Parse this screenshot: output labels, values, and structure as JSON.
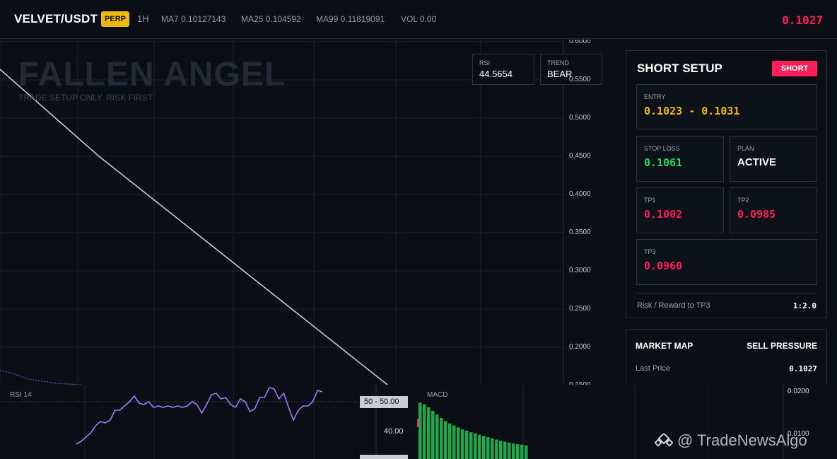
{
  "header": {
    "pair": "VELVET/USDT",
    "badge": "PERP",
    "timeframe": "1H",
    "ma7": "MA7 0.10127143",
    "ma25": "MA25 0.104592",
    "ma99": "MA99 0.11819091",
    "vol": "VOL 0.00",
    "last_price": "0.1027"
  },
  "chart": {
    "brand": "FALLEN ANGEL",
    "brand_sub": "TRADE SETUP ONLY. RISK FIRST.",
    "rsi_chip": {
      "label": "RSI",
      "value": "44.5654"
    },
    "trend_chip": {
      "label": "TREND",
      "value": "BEAR"
    },
    "price_axis": [
      "0.6000",
      "0.5500",
      "0.5000",
      "0.4500",
      "0.4000",
      "0.3500",
      "0.3000",
      "0.2500",
      "0.2000",
      "0.1500"
    ],
    "colors": {
      "line": "#c8ccd3",
      "grid": "#1c222d"
    }
  },
  "setup": {
    "title": "SHORT SETUP",
    "direction": "SHORT",
    "entry": {
      "label": "ENTRY",
      "value": "0.1023 - 0.1031"
    },
    "stop_loss": {
      "label": "STOP LOSS",
      "value": "0.1061"
    },
    "plan": {
      "label": "PLAN",
      "value": "ACTIVE"
    },
    "tp1": {
      "label": "TP1",
      "value": "0.1002"
    },
    "tp2": {
      "label": "TP2",
      "value": "0.0985"
    },
    "tp3": {
      "label": "TP3",
      "value": "0.0960"
    },
    "rr_label": "Risk / Reward to TP3",
    "rr_value": "1:2.0",
    "colors": {
      "short": "#ff1f5a",
      "entry": "#f0b90b",
      "stop": "#1ed760"
    }
  },
  "market_map": {
    "title": "MARKET MAP",
    "pressure": "SELL PRESSURE",
    "last_price_label": "Last Price",
    "last_price_value": "0.1027"
  },
  "rsi_pane": {
    "title": "RSI 14",
    "tag": "50 - 50.00",
    "tick": "40.00",
    "values": [
      20,
      22,
      25,
      28,
      33,
      36,
      35,
      37,
      44,
      44,
      47,
      50,
      54,
      49,
      48,
      50,
      46,
      47,
      46,
      47,
      46,
      47,
      46,
      47,
      50,
      48,
      42,
      48,
      55,
      56,
      52,
      53,
      48,
      46,
      52,
      50,
      43,
      45,
      53,
      53,
      60,
      59,
      52,
      56,
      46,
      37,
      44,
      47,
      47,
      50,
      58,
      57
    ],
    "color": "#9b7bff"
  },
  "macd_pane": {
    "title": "MACD",
    "ticks": [
      "0.0200",
      "0.0100"
    ],
    "bars": [
      0.0185,
      0.018,
      0.017,
      0.0158,
      0.0146,
      0.0135,
      0.0125,
      0.0117,
      0.011,
      0.0104,
      0.0098,
      0.0093,
      0.0088,
      0.0084,
      0.008,
      0.0076,
      0.0072,
      0.0068,
      0.0064,
      0.006,
      0.0057,
      0.0054,
      0.0051,
      0.0049,
      0.0047,
      0.0045
    ],
    "color": "#1ea84a"
  },
  "watermark": "@ TradeNewsAlgo"
}
